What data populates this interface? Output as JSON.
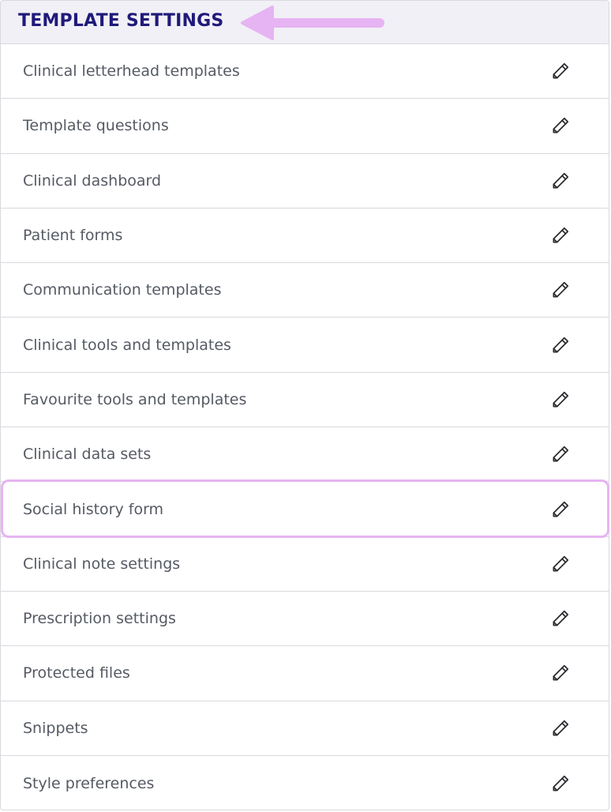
{
  "header": {
    "title": "TEMPLATE SETTINGS"
  },
  "rows": [
    {
      "label": "Clinical letterhead templates",
      "icon": "edit-pencil-icon"
    },
    {
      "label": "Template questions",
      "icon": "edit-pencil-icon"
    },
    {
      "label": "Clinical dashboard",
      "icon": "edit-pencil-icon"
    },
    {
      "label": "Patient forms",
      "icon": "edit-pencil-icon"
    },
    {
      "label": "Communication templates",
      "icon": "edit-pencil-icon"
    },
    {
      "label": "Clinical tools and templates",
      "icon": "edit-pencil-icon"
    },
    {
      "label": "Favourite tools and templates",
      "icon": "edit-pencil-icon"
    },
    {
      "label": "Clinical data sets",
      "icon": "edit-pencil-icon"
    },
    {
      "label": "Social history form",
      "icon": "edit-pencil-icon",
      "highlighted": true
    },
    {
      "label": "Clinical note settings",
      "icon": "edit-pencil-icon"
    },
    {
      "label": "Prescription settings",
      "icon": "edit-pencil-icon"
    },
    {
      "label": "Protected files",
      "icon": "edit-pencil-icon"
    },
    {
      "label": "Snippets",
      "icon": "edit-pencil-icon"
    },
    {
      "label": "Style preferences",
      "icon": "edit-pencil-icon"
    }
  ],
  "colors": {
    "title": "#1f1a7a",
    "header_bg": "#f1f0f6",
    "annotation": "#e6b4f2",
    "row_text": "#555a63"
  }
}
